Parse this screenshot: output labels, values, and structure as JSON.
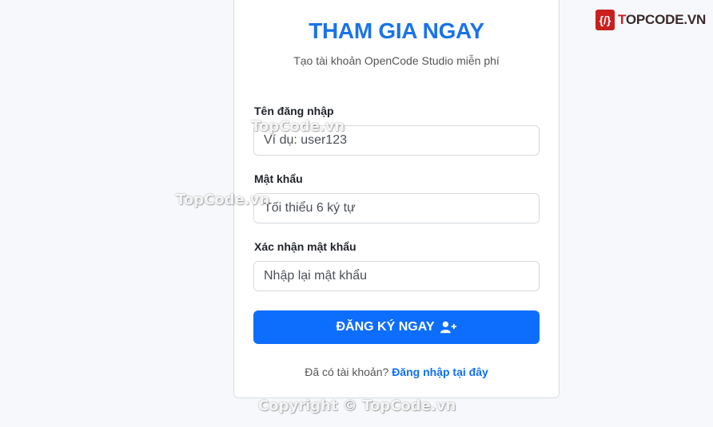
{
  "logo": {
    "badge": "{/}",
    "prefix": "T",
    "rest": "OPCODE.VN"
  },
  "card": {
    "title": "THAM GIA NGAY",
    "subtitle": "Tạo tài khoản OpenCode Studio miễn phí"
  },
  "form": {
    "username": {
      "label": "Tên đăng nhập",
      "placeholder": "Ví dụ: user123",
      "value": ""
    },
    "password": {
      "label": "Mật khẩu",
      "placeholder": "Tối thiểu 6 ký tự",
      "value": ""
    },
    "confirm": {
      "label": "Xác nhận mật khẩu",
      "placeholder": "Nhập lại mật khẩu",
      "value": ""
    },
    "submit_label": "ĐĂNG KÝ NGAY",
    "submit_icon": "user-plus-icon"
  },
  "footer": {
    "question": "Đã có tài khoản?",
    "link": "Đăng nhập tại đây"
  },
  "watermarks": {
    "w1": "TopCode.vn",
    "w2": "TopCode.vn",
    "copyright": "Copyright © TopCode.vn"
  },
  "colors": {
    "accent": "#1a73e8",
    "button": "#0d6efd",
    "brand": "#c9201f"
  }
}
